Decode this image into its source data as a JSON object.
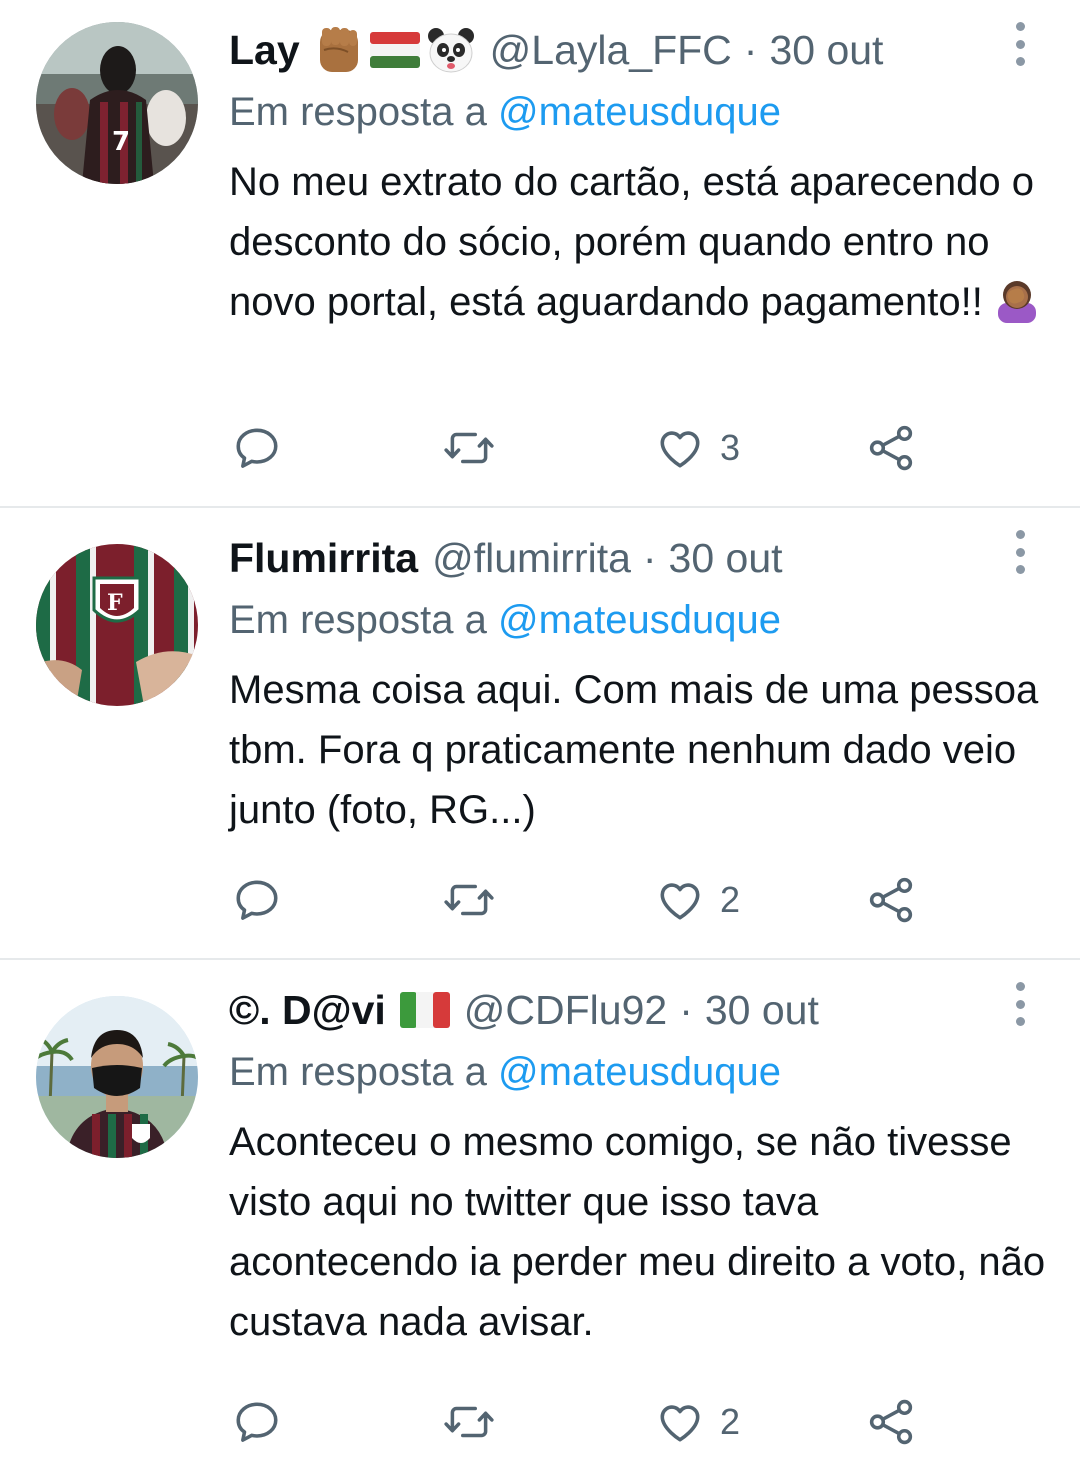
{
  "tweets": [
    {
      "name": "Lay",
      "badges": [
        "raised-fist-icon",
        "hungary-flag-icon",
        "panda-icon"
      ],
      "handle": "@Layla_FFC",
      "separator": "·",
      "date": "30 out",
      "reply_prefix": "Em resposta a",
      "reply_to": "@mateusduque",
      "text": "No meu extrato do cartão, está aparecendo o desconto do sócio, porém quando entro no novo portal, está aguardando pagamento!!",
      "text_trailing_icon": "facepalm-icon",
      "likes": "3"
    },
    {
      "name": "Flumirrita",
      "badges": [],
      "handle": "@flumirrita",
      "separator": "·",
      "date": "30 out",
      "reply_prefix": "Em resposta a",
      "reply_to": "@mateusduque",
      "text": "Mesma coisa aqui. Com mais de uma pessoa tbm. Fora q praticamente nenhum dado veio junto (foto, RG...)",
      "likes": "2"
    },
    {
      "name": "©. D@vi",
      "badges": [
        "italy-flag-icon"
      ],
      "handle": "@CDFlu92",
      "separator": "·",
      "date": "30 out",
      "reply_prefix": "Em resposta a",
      "reply_to": "@mateusduque",
      "text": "Aconteceu o mesmo comigo, se não tivesse visto aqui no twitter que isso tava acontecendo ia perder meu direito a voto, não custava nada avisar.",
      "likes": "2"
    }
  ],
  "colors": {
    "text": "#0f1419",
    "secondary": "#536471",
    "link": "#1d9bf0",
    "divider": "#e6e9eb"
  }
}
